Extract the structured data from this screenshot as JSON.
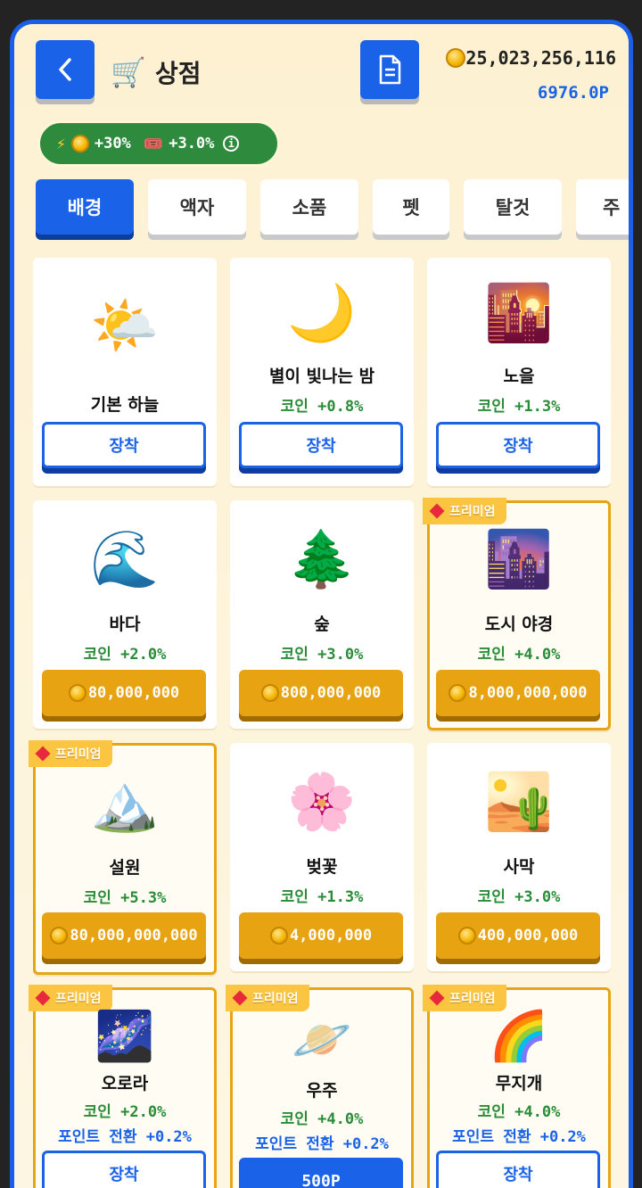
{
  "header": {
    "title": "상점",
    "coins": "25,023,256,116",
    "points": "6976.0P"
  },
  "bonus": {
    "coin_bonus": "+30%",
    "ticket_bonus": "+3.0%"
  },
  "tabs": [
    "배경",
    "액자",
    "소품",
    "펫",
    "탈것",
    "주"
  ],
  "items": [
    {
      "icon": "🌤️",
      "name": "기본 하늘",
      "stat": "",
      "stat2": "",
      "button": "장착"
    },
    {
      "icon": "🌙",
      "name": "별이 빛나는 밤",
      "stat": "코인 +0.8%",
      "stat2": "",
      "button": "장착"
    },
    {
      "icon": "🌇",
      "name": "노을",
      "stat": "코인 +1.3%",
      "stat2": "",
      "button": "장착"
    },
    {
      "icon": "🌊",
      "name": "바다",
      "stat": "코인 +2.0%",
      "stat2": "",
      "button": "80,000,000"
    },
    {
      "icon": "🌲",
      "name": "숲",
      "stat": "코인 +3.0%",
      "stat2": "",
      "button": "800,000,000"
    },
    {
      "icon": "🌆",
      "name": "도시 야경",
      "stat": "코인 +4.0%",
      "stat2": "",
      "button": "8,000,000,000",
      "badge": "프리미엄"
    },
    {
      "icon": "🏔️",
      "name": "설원",
      "stat": "코인 +5.3%",
      "stat2": "",
      "button": "80,000,000,000",
      "badge": "프리미엄"
    },
    {
      "icon": "🌸",
      "name": "벚꽃",
      "stat": "코인 +1.3%",
      "stat2": "",
      "button": "4,000,000"
    },
    {
      "icon": "🏜️",
      "name": "사막",
      "stat": "코인 +3.0%",
      "stat2": "",
      "button": "400,000,000"
    },
    {
      "icon": "🌌",
      "name": "오로라",
      "stat": "코인 +2.0%",
      "stat2": "포인트 전환 +0.2%",
      "button": "장착",
      "badge": "프리미엄"
    },
    {
      "icon": "🪐",
      "name": "우주",
      "stat": "코인 +4.0%",
      "stat2": "포인트 전환 +0.2%",
      "button": "500P",
      "badge": "프리미엄"
    },
    {
      "icon": "🌈",
      "name": "무지개",
      "stat": "코인 +4.0%",
      "stat2": "포인트 전환 +0.2%",
      "button": "장착",
      "badge": "프리미엄"
    }
  ]
}
